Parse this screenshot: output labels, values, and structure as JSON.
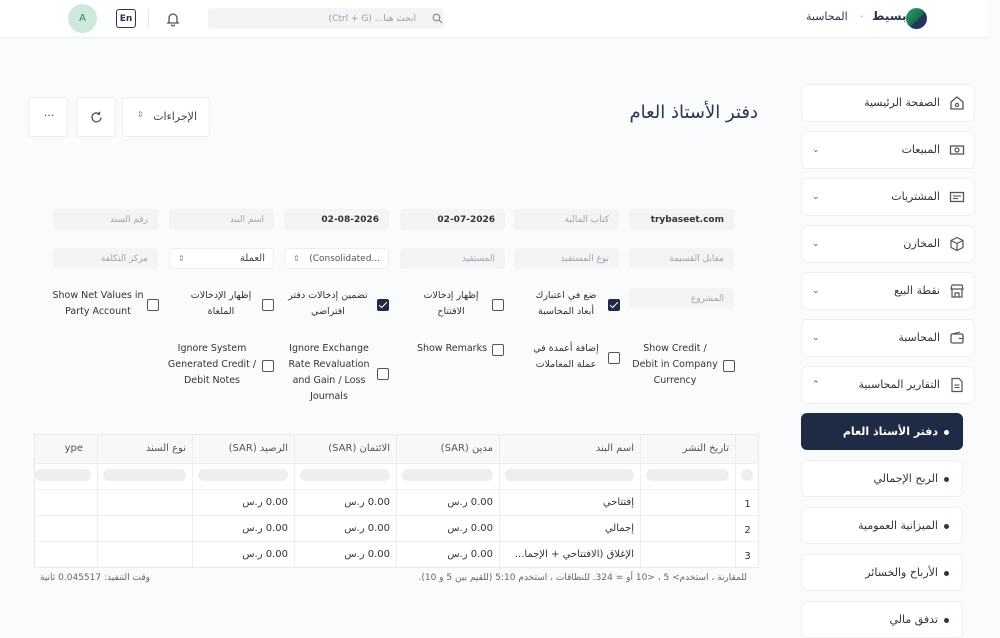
{
  "header": {
    "avatar_initial": "A",
    "lang": "En",
    "search_placeholder": "ابحث هنا... (Ctrl + G)",
    "nav_link": "المحاسبة",
    "brand": "بسيط"
  },
  "sidebar": {
    "items": [
      {
        "label": "الصفحة الرئيسية",
        "icon": "home-icon"
      },
      {
        "label": "المبيعات",
        "icon": "cash-icon"
      },
      {
        "label": "المشتريات",
        "icon": "bill-icon"
      },
      {
        "label": "المخازن",
        "icon": "box-icon"
      },
      {
        "label": "نقطة البيع",
        "icon": "store-icon"
      },
      {
        "label": "المحاسبة",
        "icon": "wallet-icon"
      },
      {
        "label": "التقارير المحاسبية",
        "icon": "report-icon"
      }
    ],
    "sub_items": [
      {
        "label": "دفتر الأستاذ العام",
        "active": true
      },
      {
        "label": "الربح الإجمالي"
      },
      {
        "label": "الميزانية العمومية"
      },
      {
        "label": "الأرباح والخسائر"
      },
      {
        "label": "تدفق مالي"
      }
    ]
  },
  "page": {
    "title": "دفتر الأستاذ العام",
    "actions_label": "الإجراءات",
    "more_label": "···"
  },
  "filters": {
    "company": "trybaseet.com",
    "finance_book_ph": "كتاب المالية",
    "from_date": "02-07-2026",
    "to_date": "02-08-2026",
    "account_ph": "اسم البند",
    "voucher_ph": "رقم السند",
    "against_ph": "مقابل القسيمة",
    "party_type_ph": "نوع المستفيد",
    "party_ph": "المستفيد",
    "group_by": "(Consolidated...",
    "currency": "العملة",
    "cost_center_ph": "مركز التكلفة",
    "project_ph": "المشروع"
  },
  "checks": [
    {
      "label": "ضع في اعتبارك أبعاد المحاسبة",
      "checked": true
    },
    {
      "label": "إظهار إدخالات الافتتاح",
      "checked": false
    },
    {
      "label": "تضمين إدخالات دفتر افتراضي",
      "checked": true
    },
    {
      "label": "إظهار الإدخالات الملغاة",
      "checked": false
    },
    {
      "label": "Show Net Values in Party Account",
      "checked": false
    },
    {
      "label": "Show Credit / Debit in Company Currency",
      "checked": false
    },
    {
      "label": "إضافة أعمدة في عملة المعاملات",
      "checked": false
    },
    {
      "label": "Show Remarks",
      "checked": false
    },
    {
      "label": "Ignore Exchange Rate Revaluation and Gain / Loss Journals",
      "checked": false
    },
    {
      "label": "Ignore System Generated Credit / Debit Notes",
      "checked": false
    }
  ],
  "table": {
    "headers": [
      "تاريخ النشر",
      "اسم البند",
      "مدين (SAR)",
      "الائتمان (SAR)",
      "الرصيد (SAR)",
      "نوع السند",
      "ype"
    ],
    "rows": [
      {
        "n": "1",
        "account": "إفتتاحي",
        "debit": "0.00 ر.س",
        "credit": "0.00 ر.س",
        "balance": "0.00 ر.س"
      },
      {
        "n": "2",
        "account": "إجمالي",
        "debit": "0.00 ر.س",
        "credit": "0.00 ر.س",
        "balance": "0.00 ر.س"
      },
      {
        "n": "3",
        "account": "الإغلاق (الافتتاحي + الإجما...",
        "debit": "0.00 ر.س",
        "credit": "0.00 ر.س",
        "balance": "0.00 ر.س"
      }
    ]
  },
  "footer": {
    "hint": "للمقارنة ، استخدم> 5 ، <10 أو = 324. للنطاقات ، استخدم 5:10 (للقيم بين 5 و 10).",
    "exec_time": "وقت التنفيذ: 0.045517 ثانية"
  }
}
